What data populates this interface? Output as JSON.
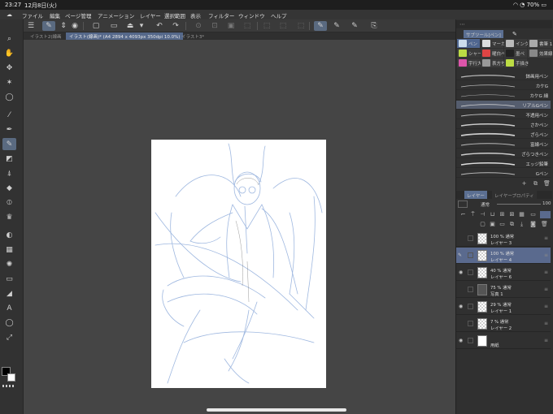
{
  "status": {
    "time": "23:27",
    "date": "12月8日(火)",
    "battery": "70%"
  },
  "menu": [
    "ファイル",
    "編集",
    "ページ管理",
    "アニメーション",
    "レイヤー",
    "選択範囲",
    "表示",
    "フィルター",
    "ウィンドウ",
    "ヘルプ"
  ],
  "tabs": [
    "イラスト2(線画",
    "イラスト(線画)* (A4 2894 x 4093px 350dpi 10.0%)",
    "イラスト3*"
  ],
  "subtool_panel": {
    "title": "サブツール[ペン]",
    "brush_tabs": [
      "ペン",
      "マーカ",
      "インク",
      "書筆 1",
      "シャー",
      "曜白ペ",
      "墨ペ",
      "効果線",
      "宇行大",
      "表方ち",
      "手描き"
    ],
    "brushes": [
      "鉢画用ペン",
      "カケG",
      "カケG 細",
      "リアルGペン",
      "不透用ペン",
      "さかペン",
      "ざらペン",
      "富線ペン",
      "ざらつきペン",
      "エッジ鉛筆",
      "Gペン"
    ]
  },
  "layer_panel": {
    "tabs": [
      "レイヤー",
      "レイヤープロパティ"
    ],
    "blend_mode": "通常",
    "opacity": "100",
    "layers": [
      {
        "line1": "100 % 通常",
        "line2": "レイヤー 3"
      },
      {
        "line1": "100 % 通常",
        "line2": "レイヤー 4"
      },
      {
        "line1": "40 % 通常",
        "line2": "レイヤー 6"
      },
      {
        "line1": "75 % 通常",
        "line2": "写真 1"
      },
      {
        "line1": "29 % 通常",
        "line2": "レイヤー 1"
      },
      {
        "line1": "7 % 通常",
        "line2": "レイヤー 2"
      },
      {
        "line1": "",
        "line2": "用紙"
      }
    ]
  },
  "colors": {
    "main": "#000000",
    "sub": "#ffffff",
    "accent": "#5a6a8e",
    "sketch": "#9fb8e0"
  }
}
